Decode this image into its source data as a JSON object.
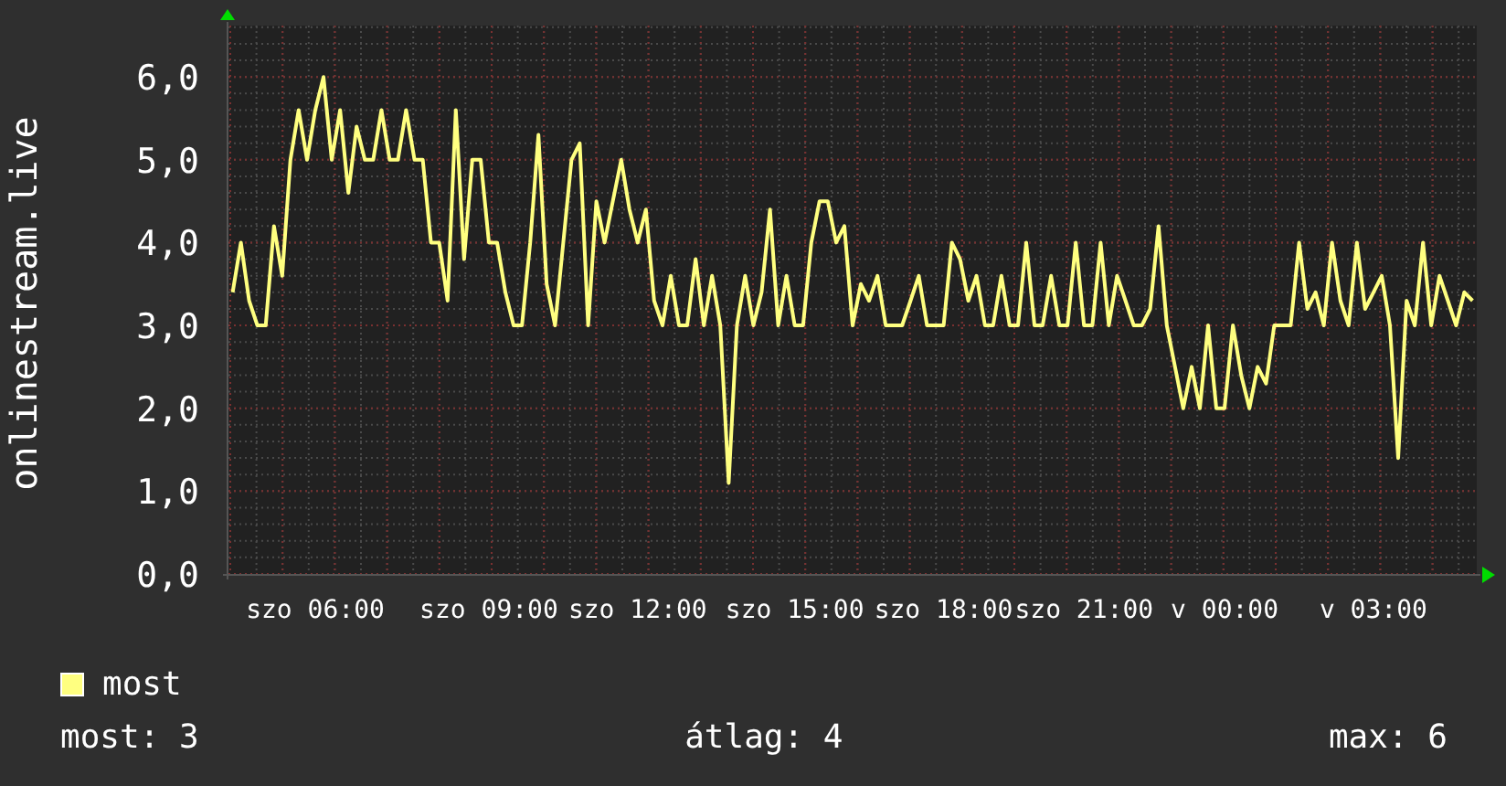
{
  "chart": {
    "chart_data": {
      "type": "line",
      "ylabel": "onlinestream.live",
      "categories": [
        null,
        null,
        null,
        null,
        null,
        null,
        null,
        null,
        null,
        null,
        "szo 06:00",
        null,
        null,
        null,
        null,
        null,
        null,
        null,
        null,
        null,
        null,
        null,
        null,
        null,
        null,
        null,
        null,
        null,
        null,
        null,
        null,
        "szo 09:00",
        null,
        null,
        null,
        null,
        null,
        null,
        null,
        null,
        null,
        null,
        null,
        null,
        null,
        null,
        null,
        null,
        null,
        "szo 12:00",
        null,
        null,
        null,
        null,
        null,
        null,
        null,
        null,
        null,
        null,
        null,
        null,
        null,
        null,
        null,
        null,
        null,
        null,
        "szo 15:00",
        null,
        null,
        null,
        null,
        null,
        null,
        null,
        null,
        null,
        null,
        null,
        null,
        null,
        null,
        null,
        null,
        null,
        "szo 18:00",
        null,
        null,
        null,
        null,
        null,
        null,
        null,
        null,
        null,
        null,
        null,
        null,
        null,
        null,
        null,
        null,
        "szo 21:00",
        null,
        null,
        null,
        null,
        null,
        null,
        null,
        null,
        null,
        null,
        null,
        null,
        null,
        null,
        null,
        null,
        "v 00:00",
        null,
        null,
        null,
        null,
        null,
        null,
        null,
        null,
        null,
        null,
        null,
        null,
        null,
        null,
        null,
        null,
        null,
        "v 03:00",
        null,
        null,
        null,
        null,
        null,
        null,
        null,
        null,
        null,
        null,
        null,
        null
      ],
      "series": [
        {
          "name": "most",
          "color": "#ffff80",
          "values": [
            3.4,
            4.0,
            3.3,
            3.0,
            3.0,
            4.2,
            3.6,
            5.0,
            5.6,
            5.0,
            5.6,
            6.0,
            5.0,
            5.6,
            4.6,
            5.4,
            5.0,
            5.0,
            5.6,
            5.0,
            5.0,
            5.6,
            5.0,
            5.0,
            4.0,
            4.0,
            3.3,
            5.6,
            3.8,
            5.0,
            5.0,
            4.0,
            4.0,
            3.4,
            3.0,
            3.0,
            4.0,
            5.3,
            3.5,
            3.0,
            4.0,
            5.0,
            5.2,
            3.0,
            4.5,
            4.0,
            4.5,
            5.0,
            4.4,
            4.0,
            4.4,
            3.3,
            3.0,
            3.6,
            3.0,
            3.0,
            3.8,
            3.0,
            3.6,
            3.0,
            1.1,
            3.0,
            3.6,
            3.0,
            3.4,
            4.4,
            3.0,
            3.6,
            3.0,
            3.0,
            4.0,
            4.5,
            4.5,
            4.0,
            4.2,
            3.0,
            3.5,
            3.3,
            3.6,
            3.0,
            3.0,
            3.0,
            3.3,
            3.6,
            3.0,
            3.0,
            3.0,
            4.0,
            3.8,
            3.3,
            3.6,
            3.0,
            3.0,
            3.6,
            3.0,
            3.0,
            4.0,
            3.0,
            3.0,
            3.6,
            3.0,
            3.0,
            4.0,
            3.0,
            3.0,
            4.0,
            3.0,
            3.6,
            3.3,
            3.0,
            3.0,
            3.2,
            4.2,
            3.0,
            2.5,
            2.0,
            2.5,
            2.0,
            3.0,
            2.0,
            2.0,
            3.0,
            2.4,
            2.0,
            2.5,
            2.3,
            3.0,
            3.0,
            3.0,
            4.0,
            3.2,
            3.4,
            3.0,
            4.0,
            3.3,
            3.0,
            4.0,
            3.2,
            3.4,
            3.6,
            3.0,
            1.4,
            3.3,
            3.0,
            4.0,
            3.0,
            3.6,
            3.3,
            3.0,
            3.4,
            3.3
          ]
        }
      ],
      "ylim": [
        0,
        6.62
      ],
      "grid": true,
      "yticks": [
        {
          "value": 0,
          "label": "0,0"
        },
        {
          "value": 1,
          "label": "1,0"
        },
        {
          "value": 2,
          "label": "2,0"
        },
        {
          "value": 3,
          "label": "3,0"
        },
        {
          "value": 4,
          "label": "4,0"
        },
        {
          "value": 5,
          "label": "5,0"
        },
        {
          "value": 6,
          "label": "6,0"
        }
      ]
    }
  },
  "stats": [
    {
      "text": "most: 3"
    },
    {
      "text": "átlag: 4"
    },
    {
      "text": "max: 6"
    }
  ]
}
